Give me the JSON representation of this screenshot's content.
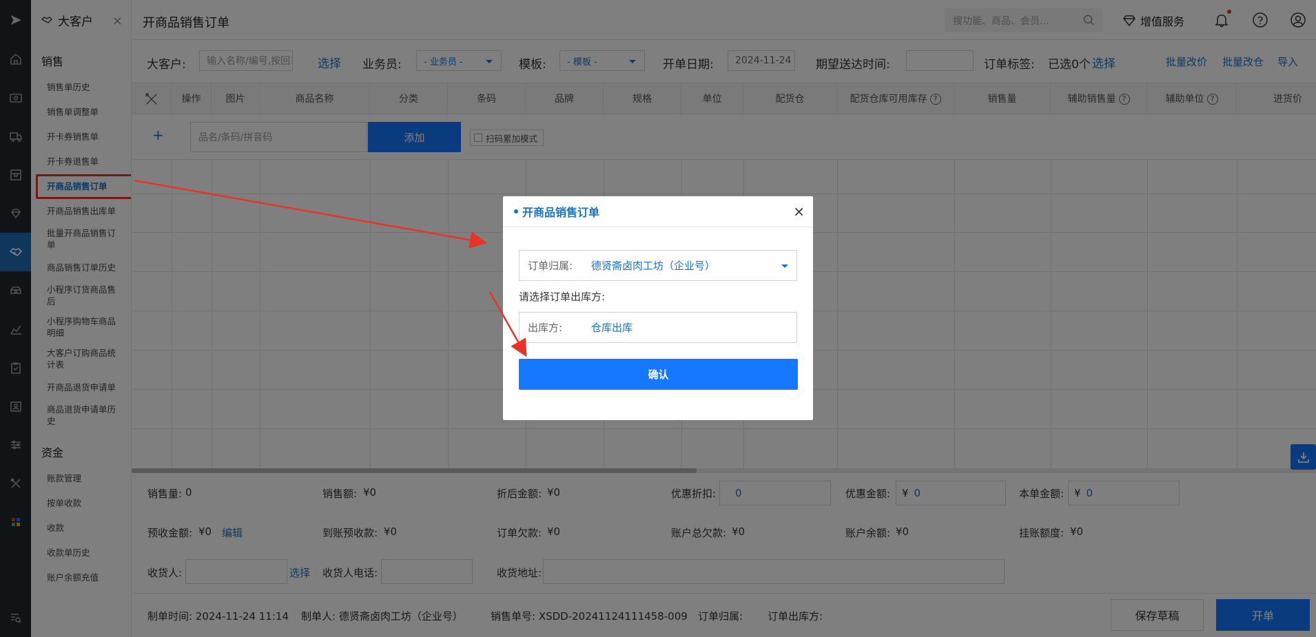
{
  "sidebar": {
    "logo_glyph": "➤",
    "module": "大客户",
    "sections": [
      {
        "title": "销售",
        "items": [
          "销售单历史",
          "销售单调整单",
          "开卡券销售单",
          "开卡券退售单",
          "开商品销售订单",
          "开商品销售出库单",
          "批量开商品销售订单",
          "商品销售订单历史",
          "小程序订货商品售后",
          "小程序购物车商品明细",
          "大客户订购商品统计表",
          "开商品退货申请单",
          "商品退货申请单历史"
        ]
      },
      {
        "title": "资金",
        "items": [
          "账款管理",
          "按单收款",
          "收款",
          "收款单历史",
          "账户余额充值"
        ]
      }
    ],
    "active_item": "开商品销售订单"
  },
  "header": {
    "title": "开商品销售订单",
    "search_placeholder": "搜功能、商品、会员...",
    "vip_label": "增值服务"
  },
  "toolbar": {
    "customer_label": "大客户:",
    "customer_placeholder": "输入名称/编号,按回车",
    "select_link": "选择",
    "salesman_label": "业务员:",
    "salesman_value": "- 业务员 -",
    "template_label": "模板:",
    "template_value": "- 模板 -",
    "date_label": "开单日期:",
    "date_value": "2024-11-24",
    "delivery_label": "期望送达时间:",
    "tag_label": "订单标签:",
    "tag_value": "已选0个",
    "tag_link": "选择",
    "batch_price": "批量改价",
    "batch_warehouse": "批量改仓",
    "import": "导入"
  },
  "grid": {
    "columns": [
      "操作",
      "图片",
      "商品名称",
      "分类",
      "条码",
      "品牌",
      "规格",
      "单位",
      "配货仓",
      "配货仓库可用库存",
      "销售量",
      "辅助销售量",
      "辅助单位",
      "进货价"
    ],
    "add_placeholder": "品名/条码/拼音码",
    "add_button": "添加",
    "scan_mode": "扫码累加模式"
  },
  "summary": {
    "qty_label": "销售量:",
    "qty_value": "0",
    "amount_label": "销售额:",
    "amount_value": "¥0",
    "discounted_label": "折后金额:",
    "discounted_value": "¥0",
    "discount_rate_label": "优惠折扣:",
    "discount_rate_value": "0",
    "discount_amount_label": "优惠金额:",
    "discount_amount_value": "0",
    "total_label": "本单金额:",
    "total_value": "0",
    "currency": "¥",
    "prepaid_label": "预收金额:",
    "prepaid_value": "¥0",
    "prepaid_edit": "编辑",
    "received_label": "到账预收款:",
    "received_value": "¥0",
    "owed_label": "订单欠款:",
    "owed_value": "¥0",
    "account_owed_label": "账户总欠款:",
    "account_owed_value": "¥0",
    "balance_label": "账户余额:",
    "balance_value": "¥0",
    "credit_label": "挂账额度:",
    "credit_value": "¥0",
    "receiver_label": "收货人:",
    "receiver_select": "选择",
    "phone_label": "收货人电话:",
    "address_label": "收货地址:"
  },
  "footer": {
    "created_time": "制单时间: 2024-11-24 11:14",
    "creator": "制单人: 德贤斋卤肉工坊（企业号）",
    "order_no": "销售单号: XSDD-20241124111458-009",
    "belong": "订单归属:",
    "outbound": "订单出库方:",
    "save_draft": "保存草稿",
    "submit": "开单"
  },
  "modal": {
    "title": "开商品销售订单",
    "belong_label": "订单归属:",
    "belong_value": "德贤斋卤肉工坊（企业号）",
    "prompt": "请选择订单出库方:",
    "outbound_label": "出库方:",
    "outbound_value": "仓库出库",
    "confirm": "确认"
  },
  "annotations": {
    "arrow_color": "#e8332a",
    "highlight_color": "#e8332a"
  },
  "colors": {
    "primary": "#1677ff",
    "link": "#1a73c7",
    "rail": "#23282e"
  }
}
